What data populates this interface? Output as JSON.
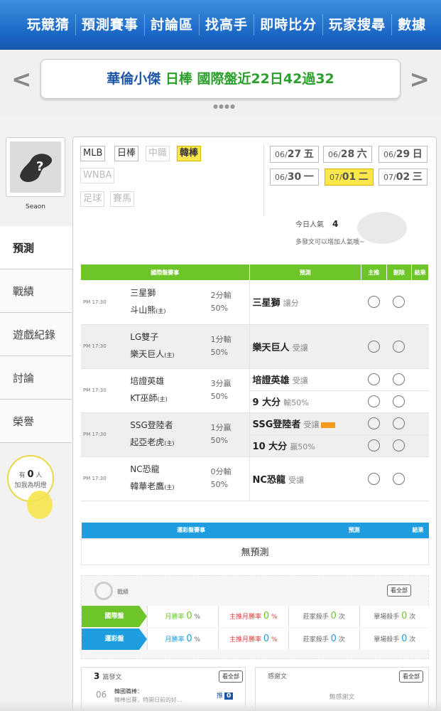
{
  "nav": [
    "玩競猜",
    "預測賽事",
    "討論區",
    "找高手",
    "即時比分",
    "玩家搜尋",
    "數據"
  ],
  "banner": {
    "prefix": "華倫小傑 ",
    "highlight": "日棒 國際盤近22日42過32",
    "left_arrow": "<",
    "right_arrow": ">"
  },
  "profile": {
    "name": "Seaon"
  },
  "sidebar": {
    "tabs": [
      "預測",
      "戰績",
      "遊戲紀錄",
      "討論",
      "榮譽"
    ],
    "fans": {
      "prefix": "有",
      "count": "0",
      "unit": "人",
      "text": "加我為明燈"
    }
  },
  "sports": {
    "row1": [
      "MLB",
      "日棒",
      "中職",
      "韓棒"
    ],
    "row2": [
      "WNBA"
    ],
    "row3": [
      "足球",
      "賽馬"
    ]
  },
  "dates": [
    {
      "md": "06/",
      "d": "27",
      "w": "五"
    },
    {
      "md": "06/",
      "d": "28",
      "w": "六"
    },
    {
      "md": "06/",
      "d": "29",
      "w": "日"
    },
    {
      "md": "06/",
      "d": "30",
      "w": "一"
    },
    {
      "md": "07/",
      "d": "01",
      "w": "二"
    },
    {
      "md": "07/",
      "d": "02",
      "w": "三"
    }
  ],
  "popularity": {
    "label": "今日人氣",
    "value": "4",
    "tip": "多發文可以增加人氣哦~"
  },
  "intl_table": {
    "headers": [
      "國際盤賽事",
      "預測",
      "主推",
      "刪除",
      "結果"
    ],
    "games": [
      {
        "time": "PM 17:30",
        "away": "三星獅",
        "home": "斗山熊",
        "home_mark": "(主)",
        "score": "2分輸",
        "pct": "50%",
        "picks": [
          {
            "main": "三星獅",
            "sub": "讓分"
          }
        ]
      },
      {
        "time": "PM 17:30",
        "away": "LG雙子",
        "home": "樂天巨人",
        "home_mark": "(主)",
        "score": "1分輸",
        "pct": "50%",
        "picks": [
          {
            "main": "樂天巨人",
            "sub": "受讓"
          }
        ]
      },
      {
        "time": "PM 17:30",
        "away": "培證英雄",
        "home": "KT巫師",
        "home_mark": "(主)",
        "score": "3分贏",
        "pct": "50%",
        "picks": [
          {
            "main": "培證英雄",
            "sub": "受讓"
          },
          {
            "main": "9 大分",
            "sub": "輸50%"
          }
        ]
      },
      {
        "time": "PM 17:30",
        "away": "SSG登陸者",
        "home": "起亞老虎",
        "home_mark": "(主)",
        "score": "1分贏",
        "pct": "50%",
        "picks": [
          {
            "main": "SSG登陸者",
            "sub": "受讓"
          },
          {
            "main": "10 大分",
            "sub": "贏50%"
          }
        ]
      },
      {
        "time": "PM 17:30",
        "away": "NC恐龍",
        "home": "韓華老鷹",
        "home_mark": "(主)",
        "score": "0分輸",
        "pct": "50%",
        "picks": [
          {
            "main": "NC恐龍",
            "sub": "受讓"
          }
        ]
      }
    ]
  },
  "lottery_table": {
    "headers": [
      "運彩盤賽事",
      "預測",
      "結果"
    ],
    "empty": "無預測"
  },
  "record": {
    "title": "戰績",
    "view_all": "看全部",
    "rows": [
      {
        "label": "國際盤",
        "color": "#6ec52a",
        "cells": [
          "月勝率",
          "0",
          "%",
          "主推月勝率",
          "0",
          "%",
          "莊家殺手",
          "0",
          "次",
          "單場殺手",
          "0",
          "次"
        ]
      },
      {
        "label": "運彩盤",
        "color": "#1e9ee0",
        "cells": [
          "月勝率",
          "0",
          "%",
          "主推月勝率",
          "0",
          "%",
          "莊家殺手",
          "0",
          "次",
          "單場殺手",
          "0",
          "次"
        ]
      }
    ]
  },
  "articles": {
    "count": "3",
    "label": "篇發文",
    "view_all": "看全部",
    "item_num": "06",
    "item_title": "韓國職棒：",
    "item_snippet": "韓棒出賽，特開日前的好…",
    "push": "推",
    "push_count": "0"
  },
  "thanks": {
    "label": "感謝文",
    "view_all": "看全部",
    "empty": "無感謝文"
  }
}
